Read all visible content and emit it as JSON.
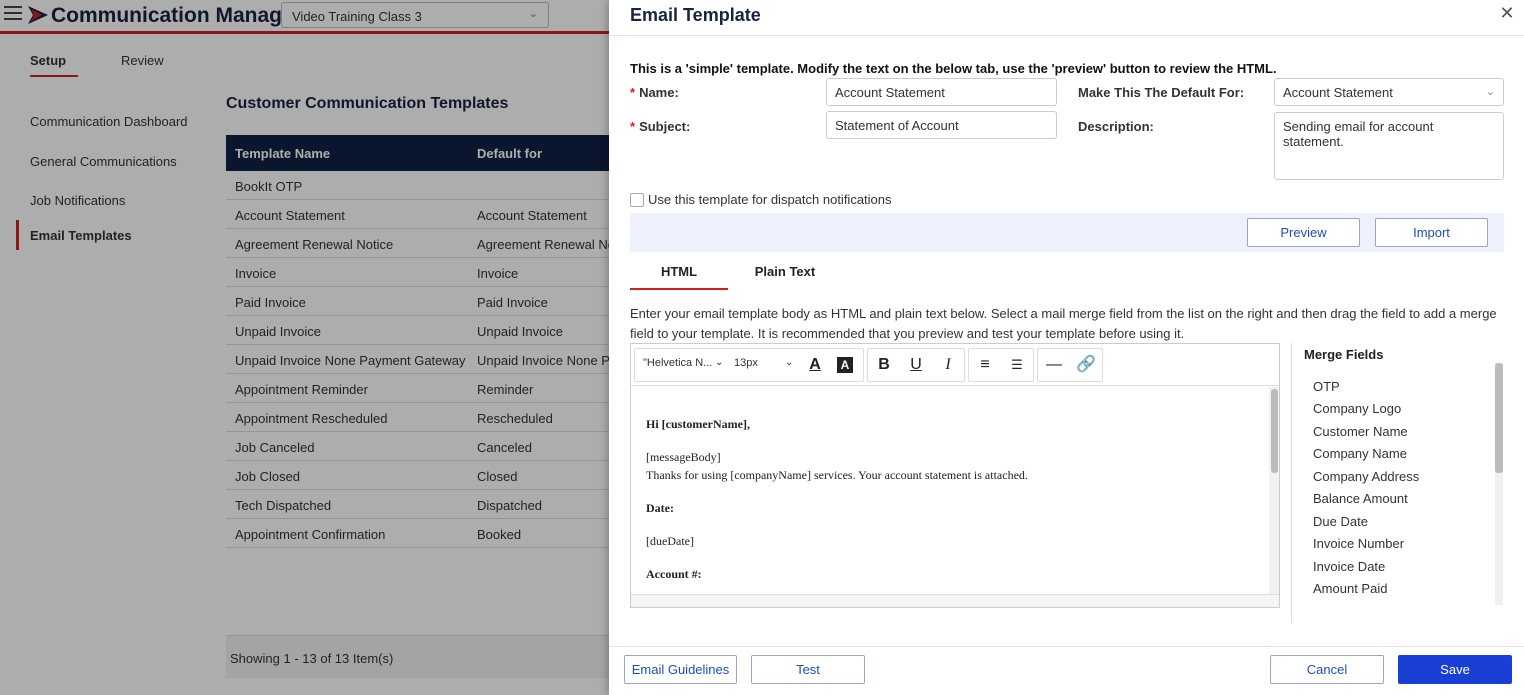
{
  "app": {
    "title": "Communication Manager",
    "class_select": "Video Training Class 3",
    "colors": {
      "brand": "#0f1f45",
      "accent": "#cc2222",
      "primary_button": "#1a3fd6"
    },
    "tabs": [
      {
        "label": "Setup",
        "active": true
      },
      {
        "label": "Review",
        "active": false
      }
    ],
    "nav": [
      {
        "label": "Communication Dashboard",
        "active": false
      },
      {
        "label": "General Communications",
        "active": false
      },
      {
        "label": "Job Notifications",
        "active": false
      },
      {
        "label": "Email Templates",
        "active": true
      }
    ]
  },
  "templates_grid": {
    "title": "Customer Communication Templates",
    "columns": [
      "Template Name",
      "Default for"
    ],
    "rows": [
      [
        "BookIt OTP",
        ""
      ],
      [
        "Account Statement",
        "Account Statement"
      ],
      [
        "Agreement Renewal Notice",
        "Agreement Renewal No"
      ],
      [
        "Invoice",
        "Invoice"
      ],
      [
        "Paid Invoice",
        "Paid Invoice"
      ],
      [
        "Unpaid Invoice",
        "Unpaid Invoice"
      ],
      [
        "Unpaid Invoice None Payment Gateway",
        "Unpaid Invoice None Pa"
      ],
      [
        "Appointment Reminder",
        "Reminder"
      ],
      [
        "Appointment Rescheduled",
        "Rescheduled"
      ],
      [
        "Job Canceled",
        "Canceled"
      ],
      [
        "Job Closed",
        "Closed"
      ],
      [
        "Tech Dispatched",
        "Dispatched"
      ],
      [
        "Appointment Confirmation",
        "Booked"
      ]
    ],
    "footer": "Showing 1 - 13 of 13 Item(s)"
  },
  "modal": {
    "title": "Email Template",
    "close_icon": "close-icon",
    "intro": "This is a 'simple' template. Modify the text on the below tab, use the 'preview' button to review the HTML.",
    "name_label": "Name:",
    "name_value": "Account Statement",
    "subject_label": "Subject:",
    "subject_value": "Statement of Account",
    "default_for_label": "Make This The Default For:",
    "default_for_value": "Account Statement",
    "description_label": "Description:",
    "description_value": "Sending email for account statement.",
    "dispatch_checkbox_label": "Use this template for dispatch notifications",
    "preview_label": "Preview",
    "import_label": "Import",
    "body_tabs": [
      {
        "label": "HTML",
        "active": true
      },
      {
        "label": "Plain Text",
        "active": false
      }
    ],
    "help_text": "Enter your email template body as HTML and plain text below. Select a mail merge field from the list on the right and then drag the field to add a merge field to your template. It is recommended that you preview and test your template before using it.",
    "editor": {
      "font_family": "\"Helvetica N...",
      "font_size": "13px",
      "content": {
        "greeting": "Hi [customerName],",
        "message_body": "[messageBody]",
        "thanks": "Thanks for using [companyName] services. Your account statement is attached.",
        "date_label": "Date:",
        "due_date": "[dueDate]",
        "account_label": "Account #:"
      }
    },
    "merge_fields": {
      "title": "Merge Fields",
      "items": [
        "OTP",
        "Company Logo",
        "Customer Name",
        "Company Name",
        "Company Address",
        "Balance Amount",
        "Due Date",
        "Invoice Number",
        "Invoice Date",
        "Amount Paid"
      ]
    },
    "footer": {
      "guidelines_label": "Email Guidelines",
      "test_label": "Test",
      "cancel_label": "Cancel",
      "save_label": "Save"
    }
  }
}
